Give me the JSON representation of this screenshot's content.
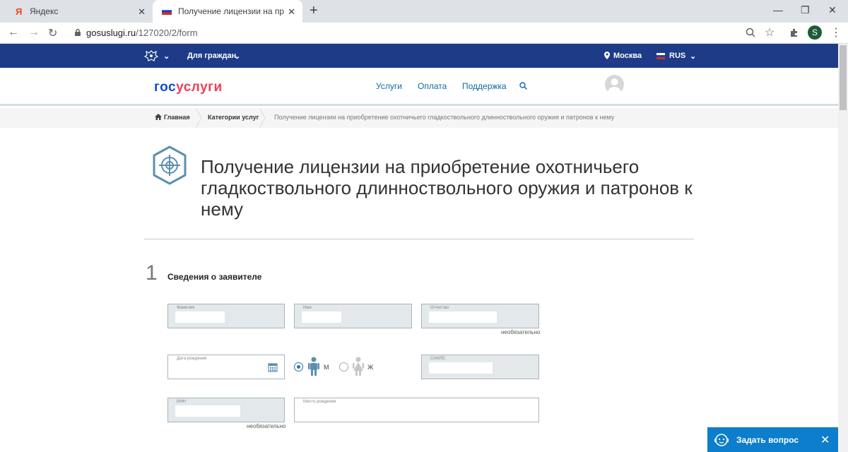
{
  "browser": {
    "tabs": [
      {
        "title": "Яндекс",
        "favicon": "yandex-icon",
        "active": false
      },
      {
        "title": "Получение лицензии на приобр",
        "favicon": "russia-flag-icon",
        "active": true
      }
    ],
    "url_host": "gosuslugi.ru",
    "url_path": "/127020/2/form",
    "profile_initial": "S"
  },
  "topbar": {
    "audience": "Для граждан",
    "location": "Москва",
    "language": "RUS",
    "color": "#1d3b87"
  },
  "header": {
    "logo_part1": "гос",
    "logo_part2": "услуги",
    "nav": [
      "Услуги",
      "Оплата",
      "Поддержка"
    ]
  },
  "breadcrumb": {
    "home": "Главная",
    "category": "Категории услуг",
    "current": "Получение лицензии на приобретение охотничьего гладкоствольного длинноствольного оружия и патронов к нему"
  },
  "page": {
    "title": "Получение лицензии на приобретение охотничьего гладкоствольного длинноствольного оружия и патронов к нему",
    "icon": "target-icon"
  },
  "step": {
    "number": "1",
    "heading": "Сведения о заявителе"
  },
  "form": {
    "surname_label": "Фамилия",
    "name_label": "Имя",
    "patronymic_label": "Отчество",
    "optional": "необязательно",
    "birthdate_label": "Дата рождения",
    "gender_male": "М",
    "gender_female": "Ж",
    "gender_selected": "М",
    "snils_label": "СНИЛС",
    "inn_label": "ИНН",
    "birthplace_label": "Место рождения"
  },
  "chat": {
    "label": "Задать вопрос",
    "color": "#0c7ecb"
  }
}
